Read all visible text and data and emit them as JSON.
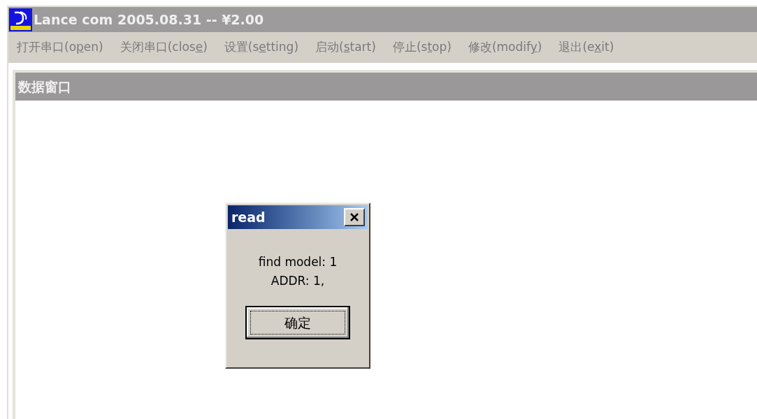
{
  "window": {
    "title": "Lance com  2005.08.31 -- ¥2.00"
  },
  "menu": [
    {
      "before": "打开串口(o",
      "access_key": "p",
      "after": "en)"
    },
    {
      "before": "关闭串口(clos",
      "access_key": "e",
      "after": ")"
    },
    {
      "before": "设置(s",
      "access_key": "e",
      "after": "tting)"
    },
    {
      "before": "启动(",
      "access_key": "s",
      "after": "tart)"
    },
    {
      "before": "停止(s",
      "access_key": "t",
      "after": "op)"
    },
    {
      "before": "修改(modif",
      "access_key": "y",
      "after": ")"
    },
    {
      "before": "退出(e",
      "access_key": "x",
      "after": "it)"
    }
  ],
  "child_window": {
    "title": "数据窗口"
  },
  "dialog": {
    "title": "read",
    "lines": [
      "find model: 1",
      "ADDR: 1,"
    ],
    "button": "确定"
  }
}
